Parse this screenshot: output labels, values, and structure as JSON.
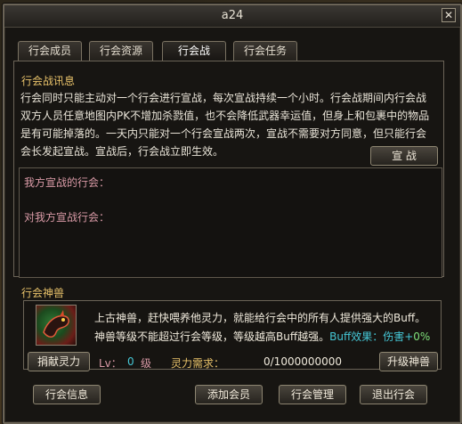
{
  "window": {
    "title": "a24"
  },
  "tabs": [
    {
      "label": "行会成员"
    },
    {
      "label": "行会资源"
    },
    {
      "label": "行会战"
    },
    {
      "label": "行会任务"
    }
  ],
  "war": {
    "section_title": "行会战讯息",
    "description_lines": [
      "行会同时只能主动对一个行会进行宣战，每次宣战持续一个小时。行会战期间内行会战",
      "双方人员任意地图内PK不增加杀戮值，也不会降低武器幸运值，但身上和包裹中的物品",
      "是有可能掉落的。一天内只能对一个行会宣战两次，宣战不需要对方同意，但只能行会",
      "会长发起宣战。宣战后，行会战立即生效。"
    ],
    "declare_button": "宣 战",
    "our_declared_label": "我方宣战的行会：",
    "declared_on_us_label": "对我方宣战行会："
  },
  "beast": {
    "section_title": "行会神兽",
    "icon": "beast-icon",
    "line1": "上古神兽，赶快喂养他灵力，就能给行会中的所有人提供强大的Buff。",
    "line2": "神兽等级不能超过行会等级，等级越高Buff越强。",
    "buff_label": "Buff效果：伤害+",
    "buff_value": "0%",
    "donate_button": "捐献灵力",
    "lv_label": "Lv：",
    "lv_value": "0",
    "lv_unit": "级",
    "spirit_label": "灵力需求：",
    "spirit_value": "0/1000000000",
    "upgrade_button": "升级神兽"
  },
  "footer": {
    "info_button": "行会信息",
    "add_member_button": "添加会员",
    "manage_button": "行会管理",
    "quit_button": "退出行会"
  }
}
